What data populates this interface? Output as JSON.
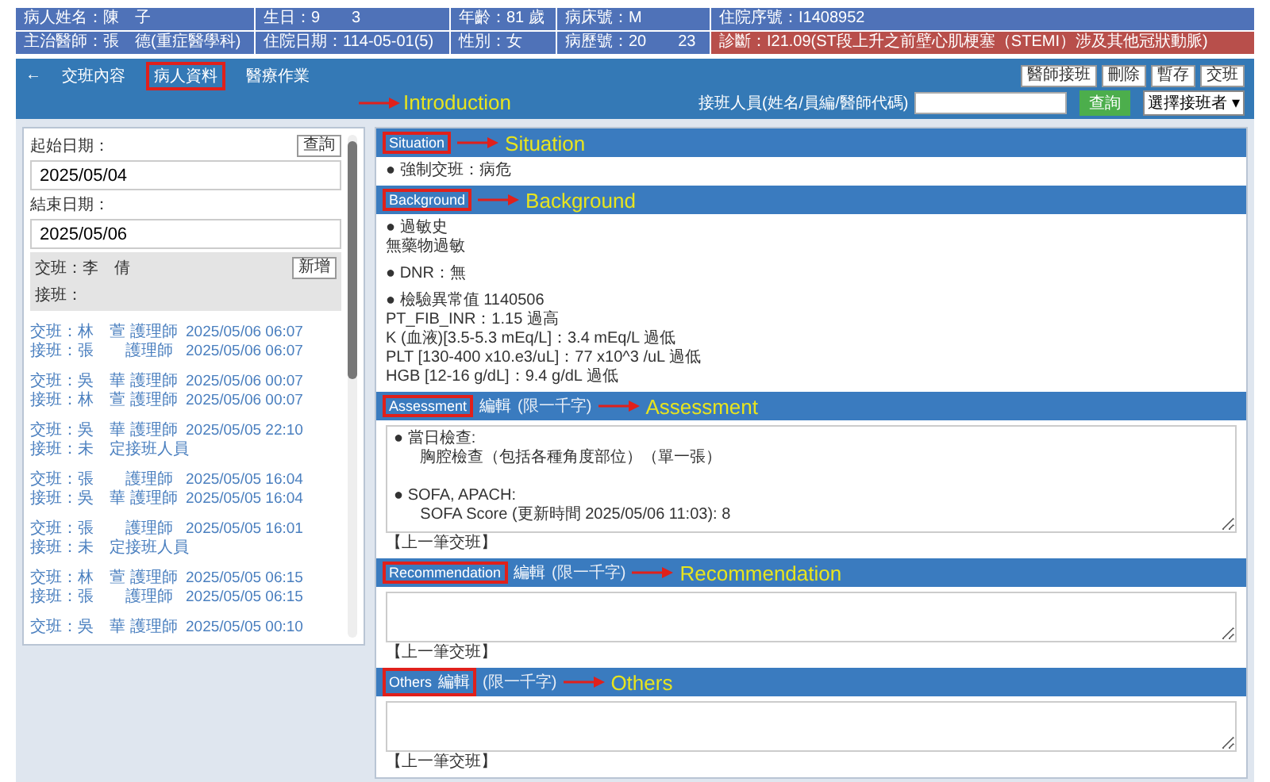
{
  "patient_header": {
    "rows": [
      [
        {
          "text": "病人姓名：陳　子",
          "kind": "plain"
        },
        {
          "text": "生日：9　　3",
          "kind": "plain"
        },
        {
          "text": "年齡：81 歲",
          "kind": "plain"
        },
        {
          "text": "病床號：M",
          "kind": "plain"
        },
        {
          "text": "住院序號：I1408952",
          "kind": "plain"
        }
      ],
      [
        {
          "text": "主治醫師：張　德(重症醫學科)",
          "kind": "plain"
        },
        {
          "text": "住院日期：114-05-01(5)",
          "kind": "plain"
        },
        {
          "text": "性別：女",
          "kind": "plain"
        },
        {
          "text": "病歷號：20　　23",
          "kind": "plain"
        },
        {
          "text": "診斷：I21.09(ST段上升之前壁心肌梗塞（STEMI）涉及其他冠狀動脈)",
          "kind": "alert"
        }
      ]
    ]
  },
  "nav": {
    "back": "←",
    "tabs": [
      {
        "label": "交班內容",
        "annotated": false
      },
      {
        "label": "病人資料",
        "annotated": true
      },
      {
        "label": "醫療作業",
        "annotated": false
      }
    ],
    "annotation": "Introduction",
    "buttons": [
      "醫師接班",
      "刪除",
      "暫存",
      "交班"
    ],
    "receiver_label": "接班人員(姓名/員編/醫師代碼)",
    "search_button": "查詢",
    "select": "選擇接班者",
    "select_caret": "▾"
  },
  "left_panel": {
    "start_label": "起始日期：",
    "query_button": "查詢",
    "start_date": "2025/05/04",
    "end_label": "結束日期：",
    "end_date": "2025/05/06",
    "current_handover": "交班：李　倩",
    "add_button": "新增",
    "current_receiver": "接班：",
    "records": [
      {
        "handover": "交班：林　萱 護理師",
        "handover_time": "2025/05/06 06:07",
        "receiver": "接班：張　　護理師",
        "receiver_time": "2025/05/06 06:07"
      },
      {
        "handover": "交班：吳　華 護理師",
        "handover_time": "2025/05/06 00:07",
        "receiver": "接班：林　萱 護理師",
        "receiver_time": "2025/05/06 00:07"
      },
      {
        "handover": "交班：吳　華 護理師",
        "handover_time": "2025/05/05 22:10",
        "receiver": "接班：未　定接班人員"
      },
      {
        "handover": "交班：張　　護理師",
        "handover_time": "2025/05/05 16:04",
        "receiver": "接班：吳　華 護理師",
        "receiver_time": "2025/05/05 16:04"
      },
      {
        "handover": "交班：張　　護理師",
        "handover_time": "2025/05/05 16:01",
        "receiver": "接班：未　定接班人員"
      },
      {
        "handover": "交班：林　萱 護理師",
        "handover_time": "2025/05/05 06:15",
        "receiver": "接班：張　　護理師",
        "receiver_time": "2025/05/05 06:15"
      },
      {
        "handover": "交班：吳　華 護理師",
        "handover_time": "2025/05/05 00:10"
      }
    ]
  },
  "sections": [
    {
      "kind": "text",
      "label": "Situation",
      "annotation": "Situation",
      "groups": [
        {
          "title": "● 強制交班：病危"
        }
      ]
    },
    {
      "kind": "text",
      "label": "Background",
      "annotation": "Background",
      "groups": [
        {
          "title": "● 過敏史",
          "lines": [
            "無藥物過敏"
          ]
        },
        {
          "title": "● DNR：無"
        },
        {
          "title": "● 檢驗異常值 1140506",
          "lines": [
            "PT_FIB_INR：1.15 過高",
            "K (血液)[3.5-5.3 mEq/L]：3.4 mEq/L 過低",
            "PLT [130-400 x10.e3/uL]：77 x10^3 /uL 過低",
            "HGB [12-16 g/dL]：9.4 g/dL 過低"
          ]
        }
      ]
    },
    {
      "kind": "textarea",
      "label": "Assessment",
      "edit": "編輯",
      "limit": "(限一千字)",
      "annotation": "Assessment",
      "value": "● 當日檢查:\n      胸腔檢查（包括各種角度部位）（單一張）\n\n● SOFA, APACH:\n      SOFA Score (更新時間 2025/05/06 11:03): 8",
      "prev": "【上一筆交班】"
    },
    {
      "kind": "textarea",
      "label": "Recommendation",
      "edit": "編輯",
      "limit": "(限一千字)",
      "annotation": "Recommendation",
      "prev": "【上一筆交班】"
    },
    {
      "kind": "textarea",
      "label": "Others",
      "edit": "編輯",
      "limit": "(限一千字)",
      "annotation": "Others",
      "edit_in_box": true,
      "prev": "【上一筆交班】"
    }
  ]
}
